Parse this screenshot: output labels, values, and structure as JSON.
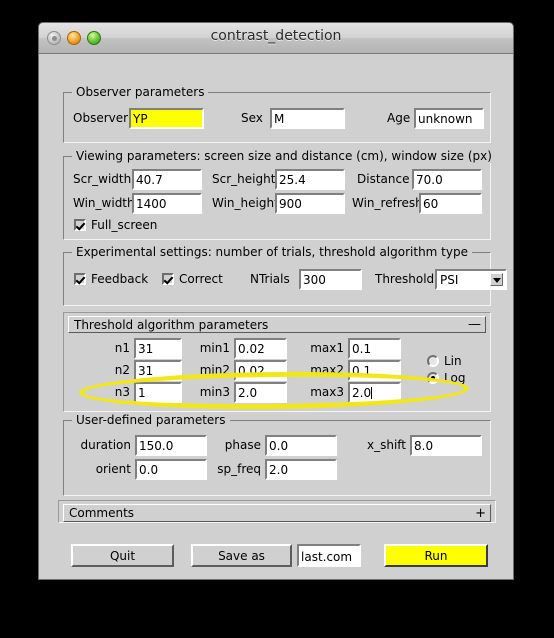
{
  "window": {
    "title": "contrast_detection",
    "traffic_lights": [
      {
        "name": "close-button",
        "color": "#a9a9a9"
      },
      {
        "name": "minimize-button",
        "color": "#f7b03b"
      },
      {
        "name": "zoom-button",
        "color": "#76cf3e"
      }
    ]
  },
  "observer": {
    "legend": "Observer parameters",
    "observer_label": "Observer",
    "observer_value": "YP",
    "observer_highlight_color": "#ffff00",
    "sex_label": "Sex",
    "sex_value": "M",
    "age_label": "Age",
    "age_value": "unknown"
  },
  "viewing": {
    "legend": "Viewing parameters: screen size and distance (cm), window size (px)",
    "scr_width_label": "Scr_width",
    "scr_width_value": "40.7",
    "scr_height_label": "Scr_height",
    "scr_height_value": "25.4",
    "distance_label": "Distance",
    "distance_value": "70.0",
    "win_width_label": "Win_width",
    "win_width_value": "1400",
    "win_height_label": "Win_height",
    "win_height_value": "900",
    "win_refresh_label": "Win_refresh",
    "win_refresh_value": "60",
    "full_screen_label": "Full_screen",
    "full_screen_checked": true
  },
  "experimental": {
    "legend": "Experimental settings: number of trials, threshold algorithm type",
    "feedback_label": "Feedback",
    "feedback_checked": true,
    "correct_label": "Correct",
    "correct_checked": true,
    "ntrials_label": "NTrials",
    "ntrials_value": "300",
    "threshold_label": "Threshold",
    "threshold_value": "PSI",
    "threshold_options": [
      "PSI"
    ]
  },
  "threshold_panel": {
    "title": "Threshold algorithm parameters",
    "collapse_button": "—",
    "rows": [
      {
        "n_label": "n1",
        "n_value": "31",
        "min_label": "min1",
        "min_value": "0.02",
        "max_label": "max1",
        "max_value": "0.1"
      },
      {
        "n_label": "n2",
        "n_value": "31",
        "min_label": "min2",
        "min_value": "0.02",
        "max_label": "max2",
        "max_value": "0.1"
      },
      {
        "n_label": "n3",
        "n_value": "1",
        "min_label": "min3",
        "min_value": "2.0",
        "max_label": "max3",
        "max_value": "2.0"
      }
    ],
    "scale_lin_label": "Lin",
    "scale_log_label": "Log",
    "scale_selected": "Log"
  },
  "user_defined": {
    "legend": "User-defined parameters",
    "duration_label": "duration",
    "duration_value": "150.0",
    "phase_label": "phase",
    "phase_value": "0.0",
    "x_shift_label": "x_shift",
    "x_shift_value": "8.0",
    "orient_label": "orient",
    "orient_value": "0.0",
    "sp_freq_label": "sp_freq",
    "sp_freq_value": "2.0"
  },
  "comments": {
    "title": "Comments",
    "expand_button": "+"
  },
  "actions": {
    "quit_label": "Quit",
    "save_as_label": "Save as",
    "filename_value": "last.com",
    "run_label": "Run",
    "run_color": "#ffff00"
  },
  "annotation": {
    "shape": "ellipse",
    "color": "#f2e712",
    "target": "n3 / min3 / max3 row"
  }
}
